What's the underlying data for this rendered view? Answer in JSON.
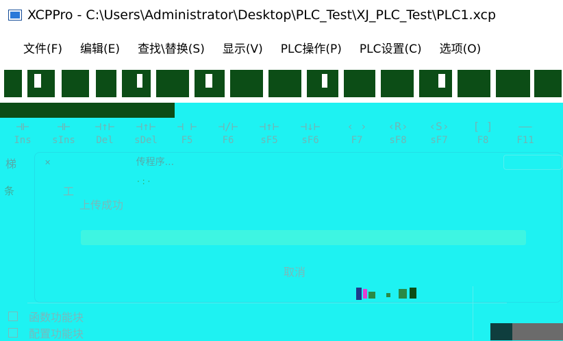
{
  "window": {
    "title": "XCPPro - C:\\Users\\Administrator\\Desktop\\PLC_Test\\XJ_PLC_Test\\PLC1.xcp",
    "icon": "app-window-icon"
  },
  "menu": [
    {
      "label": "文件(F)"
    },
    {
      "label": "编辑(E)"
    },
    {
      "label": "查找\\替换(S)"
    },
    {
      "label": "显示(V)"
    },
    {
      "label": "PLC操作(P)"
    },
    {
      "label": "PLC设置(C)"
    },
    {
      "label": "选项(O)"
    }
  ],
  "toolbar": [
    {
      "glyph": "⊣⊢",
      "key": "Ins"
    },
    {
      "glyph": "⊣⊢",
      "key": "sIns"
    },
    {
      "glyph": "⊣↑⊢",
      "key": "Del"
    },
    {
      "glyph": "⊣↑⊢",
      "key": "sDel"
    },
    {
      "glyph": "⊣ ⊢",
      "key": "F5"
    },
    {
      "glyph": "⊣/⊢",
      "key": "F6"
    },
    {
      "glyph": "⊣↑⊢",
      "key": "sF5"
    },
    {
      "glyph": "⊣↓⊢",
      "key": "sF6"
    },
    {
      "glyph": "‹ ›",
      "key": "F7"
    },
    {
      "glyph": "‹R›",
      "key": "sF8"
    },
    {
      "glyph": "‹S›",
      "key": "sF7"
    },
    {
      "glyph": "[ ]",
      "key": "F8"
    },
    {
      "glyph": "——",
      "key": "F11"
    }
  ],
  "dialog": {
    "header_text": "传程序...",
    "left_char": "梯",
    "left_char2": "条",
    "work_label": "工",
    "status": "上传成功",
    "progress": 1.0,
    "cancel_label": "取消"
  },
  "bottom": {
    "items": [
      {
        "label": "函数功能块"
      },
      {
        "label": "配置功能块"
      }
    ]
  }
}
